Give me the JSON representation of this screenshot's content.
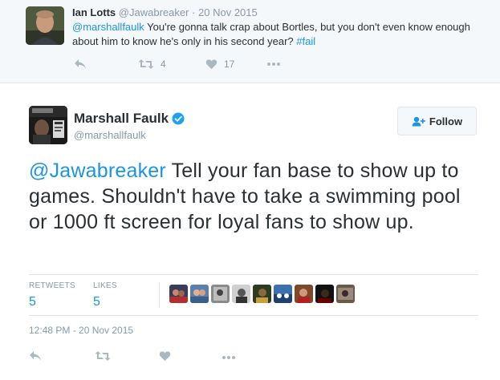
{
  "reply_tweet": {
    "author_name": "Ian Lotts",
    "author_handle": "@Jawabreaker",
    "separator": "·",
    "date": "20 Nov 2015",
    "mention": "@marshallfaulk",
    "text_body": " You're gonna talk crap about Bortles, but you don't even know enough about him to know he's only in his second year? ",
    "hashtag": "#fail",
    "actions": {
      "reply_icon": "reply-icon",
      "retweet_icon": "retweet-icon",
      "retweet_count": "4",
      "like_icon": "heart-icon",
      "like_count": "17",
      "more_icon": "more-icon"
    }
  },
  "main_tweet": {
    "author_name": "Marshall Faulk",
    "verified_icon": "verified-badge-icon",
    "author_handle": "@marshallfaulk",
    "follow_label": "Follow",
    "follow_icon": "add-user-icon",
    "mention": "@Jawabreaker",
    "text_body": " Tell your fan base to show up to games. Shouldn't have to take a swimming pool or 1000 ft screen for loyal fans to show up.",
    "stats": {
      "retweets_label": "RETWEETS",
      "retweets_value": "5",
      "likes_label": "LIKES",
      "likes_value": "5"
    },
    "timestamp": "12:48 PM - 20 Nov 2015",
    "actions": {
      "reply_icon": "reply-icon",
      "retweet_icon": "retweet-icon",
      "like_icon": "heart-icon",
      "more_icon": "more-icon"
    }
  },
  "colors": {
    "link": "#1b95e0",
    "muted": "#8899a6",
    "icon": "#aab8c2",
    "text": "#292f33",
    "verified": "#1da1f2",
    "reply_bg": "#f5f8fa"
  }
}
